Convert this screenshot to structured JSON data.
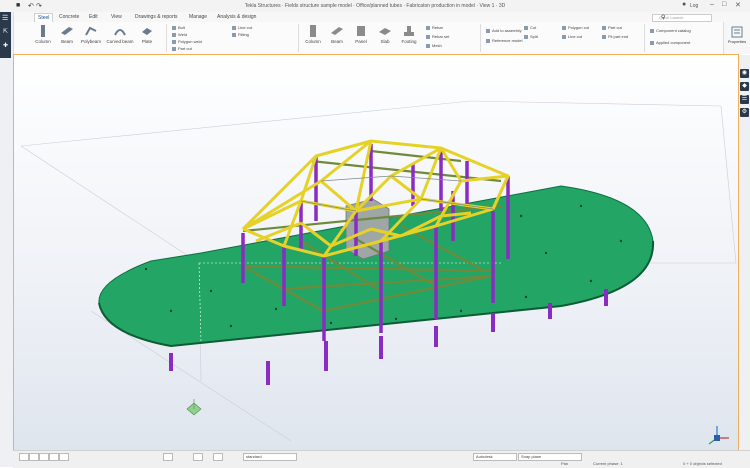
{
  "titlebar": {
    "title": "Tekla Structures · Fields structure sample model · Office/planned tubes · Fabricaton production in model · View 1 · 3D",
    "user": "Log"
  },
  "menu": {
    "tabs": [
      "Steel",
      "Concrete",
      "Edit",
      "View",
      "Drawings & reports",
      "Manage",
      "Analysis & design"
    ],
    "search_placeholder": "Quick Launch"
  },
  "ribbon": {
    "steel_buttons": [
      "Column",
      "Beam",
      "Polybeam",
      "Curved beam",
      "Plate"
    ],
    "small_items": [
      "Bolt",
      "Weld",
      "Polygon weld",
      "Part cut",
      "Line cut",
      "Fitting"
    ],
    "concrete_buttons": [
      "Column",
      "Beam",
      "Panel",
      "Slab",
      "Footing"
    ],
    "cast_items": [
      "Rebar",
      "Rebar set",
      "Mesh"
    ],
    "assembly_items": [
      "Add to assembly",
      "Reference model",
      "Cut",
      "Split"
    ],
    "edit_items": [
      "Polygon cut",
      "Line cut",
      "Part cut",
      "Fit part end"
    ],
    "right_items": [
      "Component catalog",
      "Applied component"
    ],
    "properties_label": "Properties"
  },
  "status": {
    "selection_label": "standard",
    "mode": "Autodesk",
    "snap_label": "Snap plane",
    "pan_label": "Pan",
    "phase": "Current phase: 1",
    "selected": "0 + 0 objects selected"
  },
  "colors": {
    "slab": "#22a565",
    "slab_edge": "#0e6e40",
    "steel_yellow": "#e6d227",
    "column_purple": "#8a2cc2",
    "viewport_border": "#f0b15a",
    "titlebar": "#f3f3f3"
  }
}
